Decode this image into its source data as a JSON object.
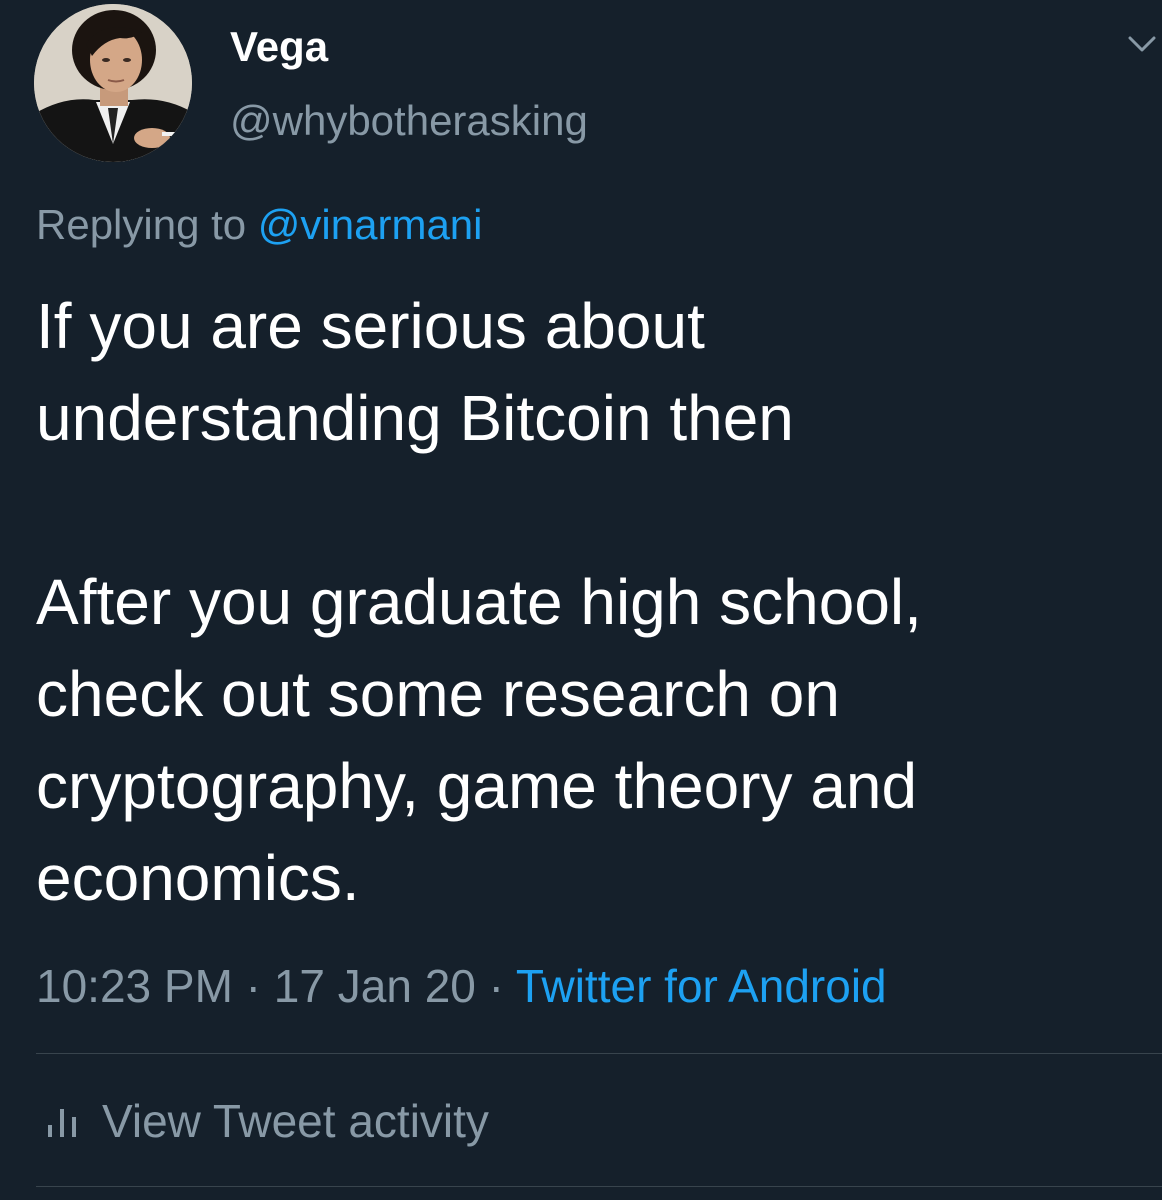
{
  "theme": {
    "background": "#15202b",
    "primary_text": "#ffffff",
    "secondary_text": "#8899a6",
    "accent": "#1da1f2",
    "divider": "#38444d"
  },
  "tweet": {
    "author": {
      "display_name": "Vega",
      "handle": "@whybotherasking",
      "avatar_icon": "profile-photo"
    },
    "reply": {
      "prefix": "Replying to ",
      "mention": "@vinarmani"
    },
    "text_lines": [
      "If you are serious about",
      "understanding Bitcoin then",
      "",
      "After you graduate high school,",
      "check out some research on",
      "cryptography, game theory and",
      "economics."
    ],
    "time": "10:23 PM",
    "separator": " · ",
    "date": "17 Jan 20",
    "source": "Twitter for Android",
    "menu_icon": "chevron-down-icon"
  },
  "activity": {
    "icon": "bar-chart-icon",
    "label": "View Tweet activity"
  }
}
